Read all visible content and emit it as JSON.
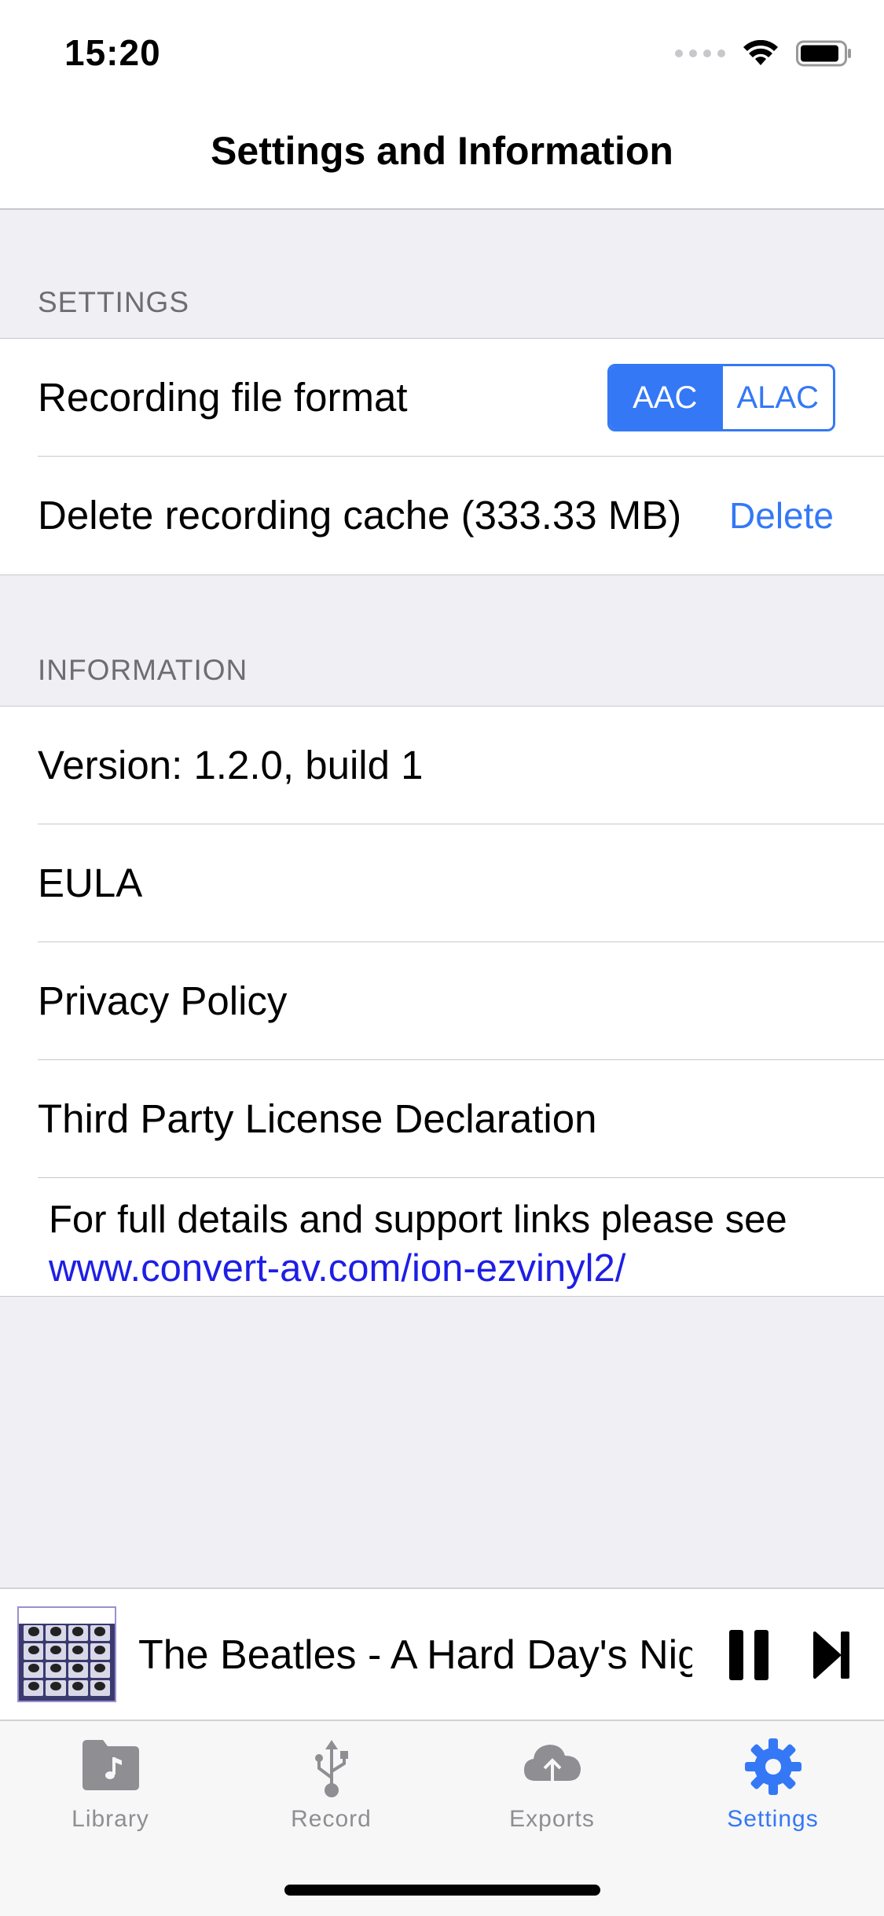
{
  "status_bar": {
    "time": "15:20"
  },
  "nav": {
    "title": "Settings and Information"
  },
  "settings": {
    "header": "SETTINGS",
    "format_label": "Recording file format",
    "format_options": [
      "AAC",
      "ALAC"
    ],
    "format_selected": "AAC",
    "cache_label": "Delete recording cache (333.33 MB)",
    "delete_label": "Delete"
  },
  "information": {
    "header": "INFORMATION",
    "version": "Version: 1.2.0, build 1",
    "eula": "EULA",
    "privacy": "Privacy Policy",
    "third_party": "Third Party License Declaration",
    "details_text": "For full details and support links please see",
    "details_link": "www.convert-av.com/ion-ezvinyl2/"
  },
  "player": {
    "title": "The Beatles - A Hard Day's Night"
  },
  "tabbar": {
    "items": [
      {
        "label": "Library",
        "icon": "music-folder-icon"
      },
      {
        "label": "Record",
        "icon": "usb-icon"
      },
      {
        "label": "Exports",
        "icon": "cloud-upload-icon"
      },
      {
        "label": "Settings",
        "icon": "gear-icon"
      }
    ],
    "active": "Settings"
  },
  "colors": {
    "accent": "#3478f6",
    "link": "#1e1ee6",
    "background": "#efeff4"
  }
}
